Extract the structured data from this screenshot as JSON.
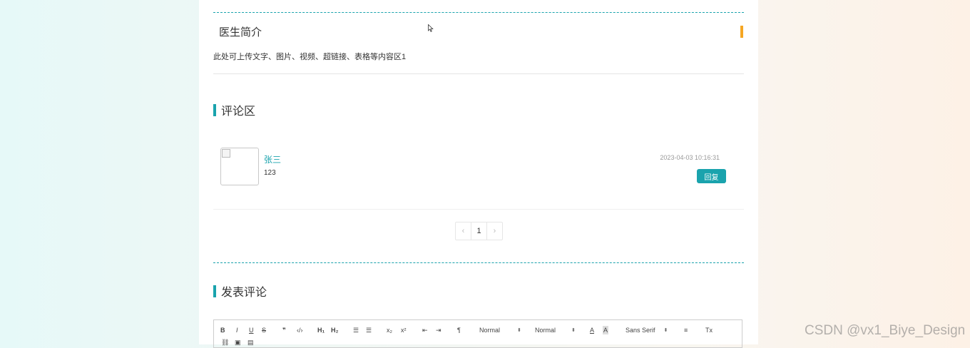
{
  "intro": {
    "title": "医生简介",
    "content": "此处可上传文字、图片、视频、超链接、表格等内容区1"
  },
  "comments_section": {
    "title": "评论区",
    "comments": [
      {
        "username": "张三",
        "text": "123",
        "time": "2023-04-03 10:16:31",
        "reply_label": "回复"
      }
    ]
  },
  "pagination": {
    "prev": "‹",
    "current": "1",
    "next": "›"
  },
  "post_comment": {
    "title": "发表评论"
  },
  "editor_toolbar": {
    "bold": "B",
    "italic": "I",
    "underline": "U",
    "strike": "S",
    "blockquote": "❞",
    "code": "‹/›",
    "h1": "H₁",
    "h2": "H₂",
    "ordered_list": "☰",
    "bullet_list": "☰",
    "subscript": "x₂",
    "superscript": "x²",
    "outdent": "⇤",
    "indent": "⇥",
    "direction": "¶",
    "size_picker": "Normal",
    "header_picker": "Normal",
    "font_color": "A",
    "background_color": "A",
    "font_picker": "Sans Serif",
    "align": "≡",
    "clean": "Tx",
    "link": "⛓",
    "image": "▣",
    "video": "▤"
  },
  "watermark": "CSDN @vx1_Biye_Design",
  "colors": {
    "accent": "#1aa3ad",
    "intro_marker": "#f5a623",
    "username": "#1aa3ad"
  }
}
